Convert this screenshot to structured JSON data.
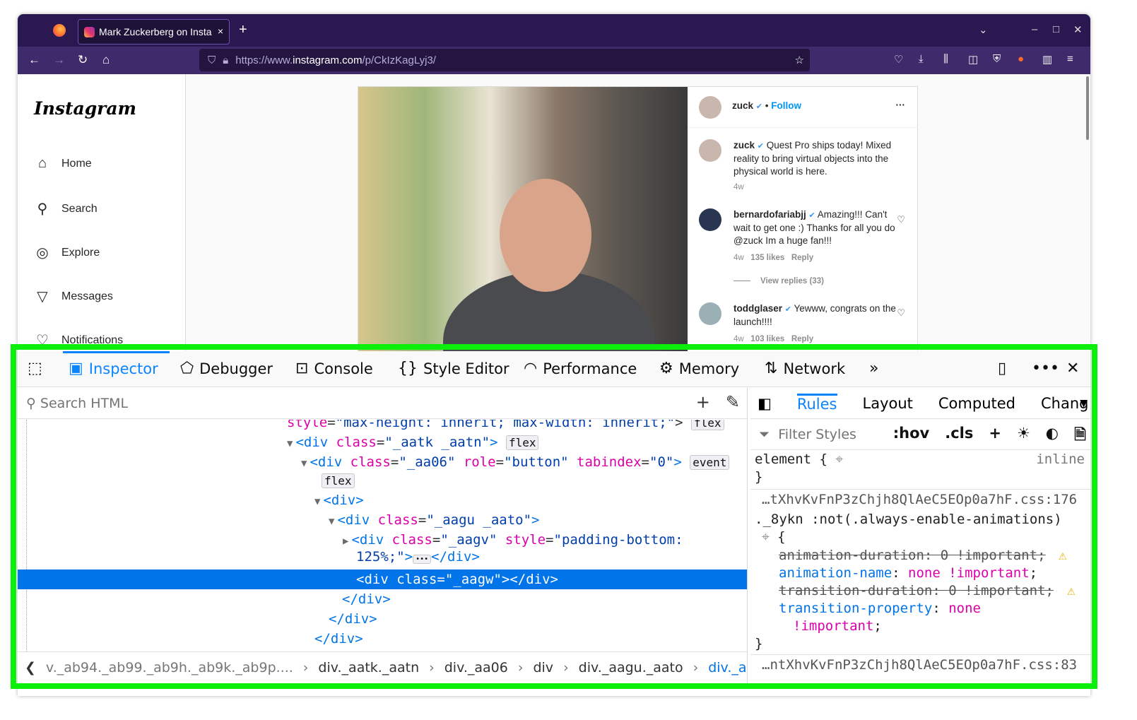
{
  "browser": {
    "tab_title": "Mark Zuckerberg on Insta",
    "url_prefix": "https://www.",
    "url_domain": "instagram.com",
    "url_path": "/p/CkIzKagLyj3/",
    "new_tab": "+",
    "close": "×"
  },
  "instagram": {
    "logo": "Instagram",
    "nav": [
      {
        "label": "Home",
        "icon": "home-icon",
        "glyph": "⌂"
      },
      {
        "label": "Search",
        "icon": "search-icon",
        "glyph": "⚲"
      },
      {
        "label": "Explore",
        "icon": "compass-icon",
        "glyph": "◎"
      },
      {
        "label": "Messages",
        "icon": "send-icon",
        "glyph": "▽"
      },
      {
        "label": "Notifications",
        "icon": "heart-icon",
        "glyph": "♡"
      }
    ],
    "post": {
      "author": "zuck",
      "dot": "•",
      "follow": "Follow",
      "more": "···",
      "caption": {
        "user": "zuck",
        "text": "Quest Pro ships today! Mixed reality to bring virtual objects into the physical world is here.",
        "time": "4w"
      },
      "comments": [
        {
          "user": "bernardofariabjj",
          "text": "Amazing!!! Can't wait to get one :) Thanks for all you do @zuck Im a huge fan!!!",
          "time": "4w",
          "likes": "135 likes",
          "reply": "Reply",
          "view_replies": "View replies (33)"
        },
        {
          "user": "toddglaser",
          "text": "Yewww, congrats on the launch!!!!",
          "time": "4w",
          "likes": "103 likes",
          "reply": "Reply"
        }
      ]
    }
  },
  "devtools": {
    "tabs": [
      "Inspector",
      "Debugger",
      "Console",
      "Style Editor",
      "Performance",
      "Memory",
      "Network"
    ],
    "search_placeholder": "Search HTML",
    "tree": {
      "l0": {
        "attr": "style",
        "val": "\"max-height: inherit; max-width: inherit;\"",
        "end": ">",
        "badge": "flex"
      },
      "l1": {
        "open": "<div",
        "attr": "class",
        "val": "\"_aatk _aatn\"",
        "end": ">",
        "badge": "flex"
      },
      "l2": {
        "open": "<div",
        "a1": "class",
        "v1": "\"_aa06\"",
        "a2": "role",
        "v2": "\"button\"",
        "a3": "tabindex",
        "v3": "\"0\"",
        "end": ">",
        "badge": "event",
        "badge2": "flex"
      },
      "l3": "<div>",
      "l4": {
        "open": "<div",
        "attr": "class",
        "val": "\"_aagu _aato\"",
        "end": ">"
      },
      "l5": {
        "open": "<div",
        "a1": "class",
        "v1": "\"_aagv\"",
        "a2": "style",
        "v2": "\"padding-bottom:",
        "v2b": "125%;\"",
        "end": ">",
        "ellipsis": "•••",
        "close": "</div>"
      },
      "l6": "<div class=\"_aagw\"></div>",
      "l7": "</div>",
      "l8": "</div>",
      "l9": "</div>"
    },
    "breadcrumbs": [
      "v._ab94._ab99._ab9h._ab9k._ab9p....",
      "div._aatk._aatn",
      "div._aa06",
      "div",
      "div._aagu._aato",
      "div._aagw"
    ],
    "side_tabs": [
      "Rules",
      "Layout",
      "Computed",
      "Chang"
    ],
    "filter_placeholder": "Filter Styles",
    "hov": ":hov",
    "cls": ".cls",
    "rules": {
      "element": "element {",
      "inline": "inline",
      "close": "}",
      "src1": "…tXhvKvFnP3zChjh8QlAeC5EOp0a7hF.css:176",
      "selector": "._8ykn :not(.always-enable-animations)",
      "open": "{",
      "decls": [
        {
          "prop": "animation-duration",
          "val": "0 !important",
          "overridden": true
        },
        {
          "prop": "animation-name",
          "val": "none !important",
          "overridden": false
        },
        {
          "prop": "transition-duration",
          "val": "0 !important",
          "overridden": true
        },
        {
          "prop": "transition-property",
          "val": "none",
          "val2": "!important",
          "overridden": false
        }
      ],
      "src2": "…ntXhvKvFnP3zChjh8QlAeC5EOp0a7hF.css:83"
    }
  },
  "colors": {
    "accent": "#0a84ff",
    "highlight": "#0074e8",
    "frame": "#2b1850",
    "annotation": "#0bf00b"
  }
}
